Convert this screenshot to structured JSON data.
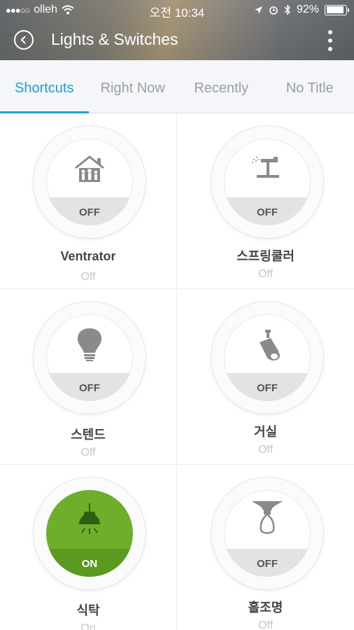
{
  "status_bar": {
    "carrier": "olleh",
    "time": "오전 10:34",
    "battery": "92%",
    "signal_icon": "signal-dots-icon",
    "wifi_icon": "wifi-icon"
  },
  "header": {
    "title": "Lights & Switches",
    "back_icon": "back-icon",
    "more_icon": "more-vert-icon"
  },
  "tabs": [
    {
      "label": "Shortcuts",
      "active": true
    },
    {
      "label": "Right Now",
      "active": false
    },
    {
      "label": "Recently",
      "active": false
    },
    {
      "label": "No Title",
      "active": false
    }
  ],
  "devices": [
    {
      "name": "Ventrator",
      "state_label": "OFF",
      "status": "Off",
      "icon": "house-icon",
      "on": false
    },
    {
      "name": "스프링쿨러",
      "state_label": "OFF",
      "status": "Off",
      "icon": "sprinkler-icon",
      "on": false
    },
    {
      "name": "스텐드",
      "state_label": "OFF",
      "status": "Off",
      "icon": "bulb-icon",
      "on": false
    },
    {
      "name": "거실",
      "state_label": "OFF",
      "status": "Off",
      "icon": "spotlight-icon",
      "on": false
    },
    {
      "name": "식탁",
      "state_label": "ON",
      "status": "On",
      "icon": "pendant-lamp-icon",
      "on": true
    },
    {
      "name": "홀조명",
      "state_label": "OFF",
      "status": "Off",
      "icon": "ceiling-lamp-icon",
      "on": false
    }
  ],
  "colors": {
    "accent": "#1aa0d8",
    "on_green": "#6eae2b",
    "icon_gray": "#8a8a8a"
  }
}
